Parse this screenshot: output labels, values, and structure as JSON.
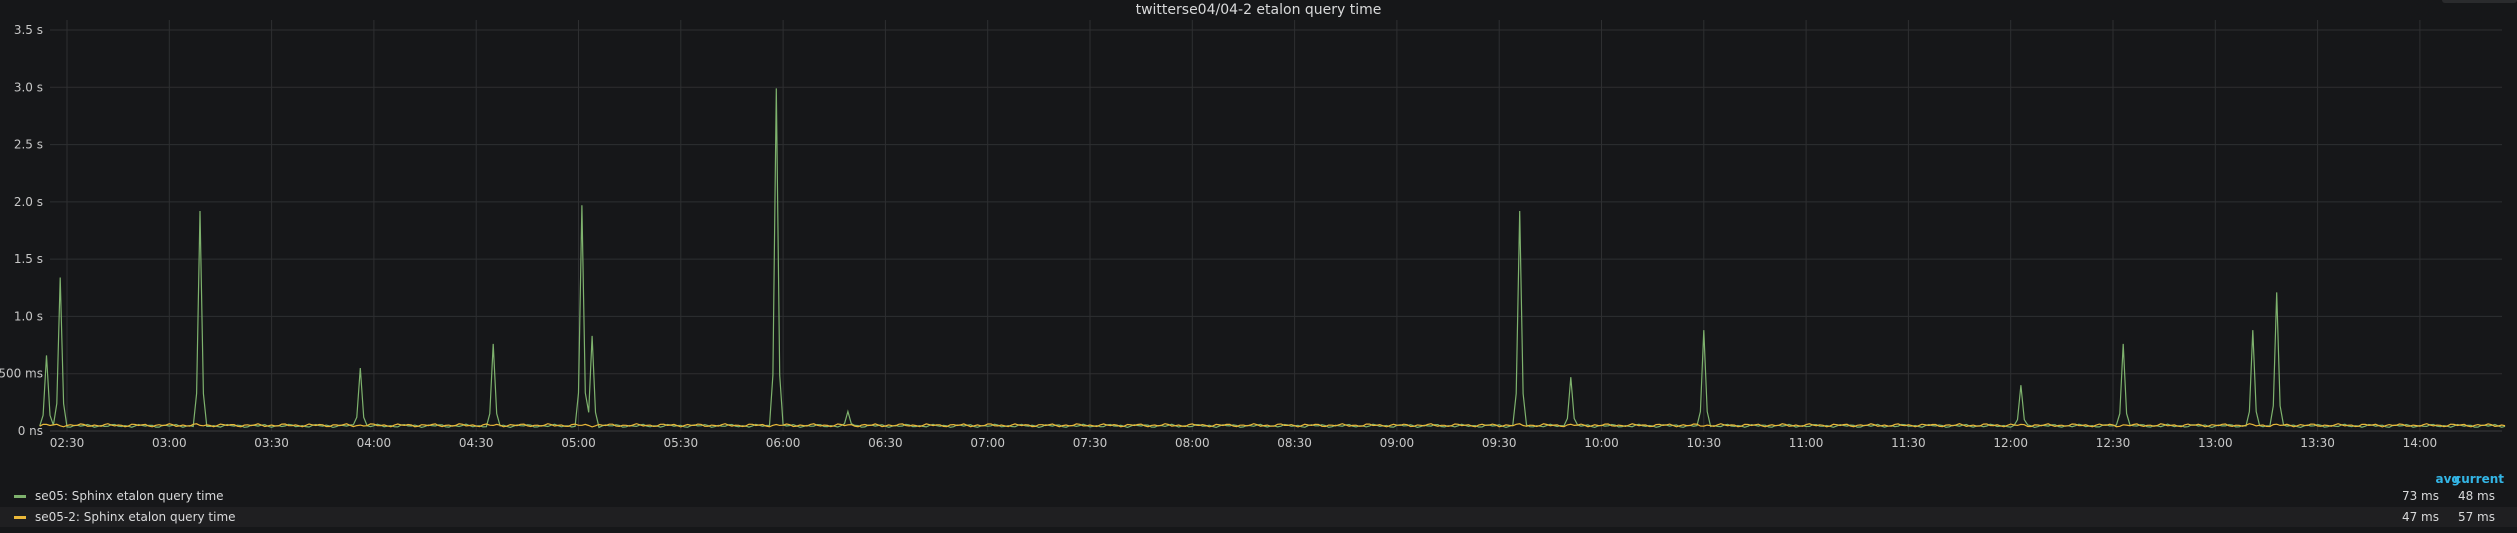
{
  "panel": {
    "title": "twitterse04/04-2 etalon query time"
  },
  "legend": {
    "col_avg": "avg",
    "col_current": "current",
    "rows": [
      {
        "name": "se05: Sphinx etalon query time",
        "color": "#7eb26d",
        "avg": "73 ms",
        "current": "48 ms"
      },
      {
        "name": "se05-2: Sphinx etalon query time",
        "color": "#eab839",
        "avg": "47 ms",
        "current": "57 ms"
      }
    ]
  },
  "chart_data": {
    "type": "line",
    "title": "twitterse04/04-2 etalon query time",
    "xlabel": "",
    "ylabel": "",
    "x_tick_labels": [
      "02:30",
      "03:00",
      "03:30",
      "04:00",
      "04:30",
      "05:00",
      "05:30",
      "06:00",
      "06:30",
      "07:00",
      "07:30",
      "08:00",
      "08:30",
      "09:00",
      "09:30",
      "10:00",
      "10:30",
      "11:00",
      "11:30",
      "12:00",
      "12:30",
      "13:00",
      "13:30",
      "14:00"
    ],
    "y_tick_labels": [
      "0 ns",
      "500 ms",
      "1.0 s",
      "1.5 s",
      "2.0 s",
      "2.5 s",
      "3.0 s",
      "3.5 s"
    ],
    "x_range": [
      "02:22",
      "14:25"
    ],
    "ylim": [
      0,
      3.5
    ],
    "y_unit": "s",
    "grid": true,
    "legend_position": "bottom",
    "baseline": {
      "se05": 0.045,
      "se05-2": 0.05
    },
    "series": [
      {
        "name": "se05: Sphinx etalon query time",
        "color": "#7eb26d",
        "spikes": [
          {
            "t": "02:24",
            "v": 0.66
          },
          {
            "t": "02:28",
            "v": 1.34
          },
          {
            "t": "03:09",
            "v": 1.92
          },
          {
            "t": "03:56",
            "v": 0.55
          },
          {
            "t": "04:35",
            "v": 0.76
          },
          {
            "t": "05:01",
            "v": 1.97
          },
          {
            "t": "05:04",
            "v": 0.83
          },
          {
            "t": "05:58",
            "v": 2.99
          },
          {
            "t": "06:19",
            "v": 0.17
          },
          {
            "t": "09:36",
            "v": 1.92
          },
          {
            "t": "09:51",
            "v": 0.47
          },
          {
            "t": "10:30",
            "v": 0.88
          },
          {
            "t": "12:03",
            "v": 0.4
          },
          {
            "t": "12:33",
            "v": 0.76
          },
          {
            "t": "13:11",
            "v": 0.88
          },
          {
            "t": "13:18",
            "v": 1.21
          }
        ]
      },
      {
        "name": "se05-2: Sphinx etalon query time",
        "color": "#eab839",
        "spikes": []
      }
    ]
  }
}
